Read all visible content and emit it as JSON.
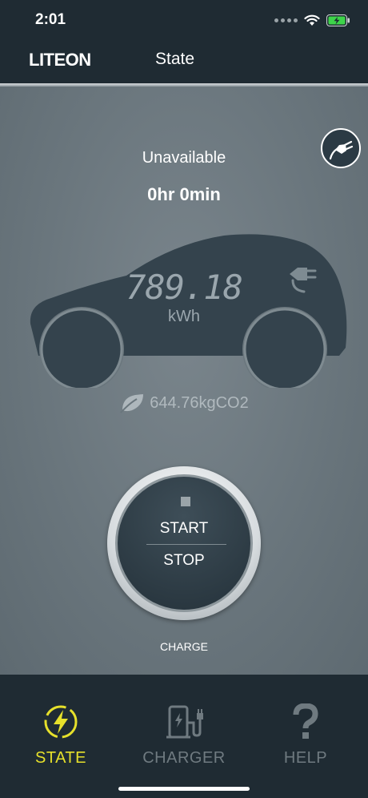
{
  "status_bar": {
    "time": "2:01"
  },
  "header": {
    "logo": "LITEON",
    "title": "State"
  },
  "main": {
    "status": "Unavailable",
    "duration": "0hr 0min",
    "energy_value": "789.18",
    "energy_unit": "kWh",
    "co2": "644.76kgCO2",
    "start_label": "START",
    "stop_label": "STOP",
    "charge_caption": "CHARGE"
  },
  "tabs": [
    {
      "label": "STATE",
      "icon": "lightning-icon",
      "active": true
    },
    {
      "label": "CHARGER",
      "icon": "charger-station-icon",
      "active": false
    },
    {
      "label": "HELP",
      "icon": "question-icon",
      "active": false
    }
  ],
  "colors": {
    "background": "#1f2b33",
    "panel": "#6a767d",
    "active_tab": "#e6e02b",
    "inactive_tab": "#6f7a80"
  }
}
